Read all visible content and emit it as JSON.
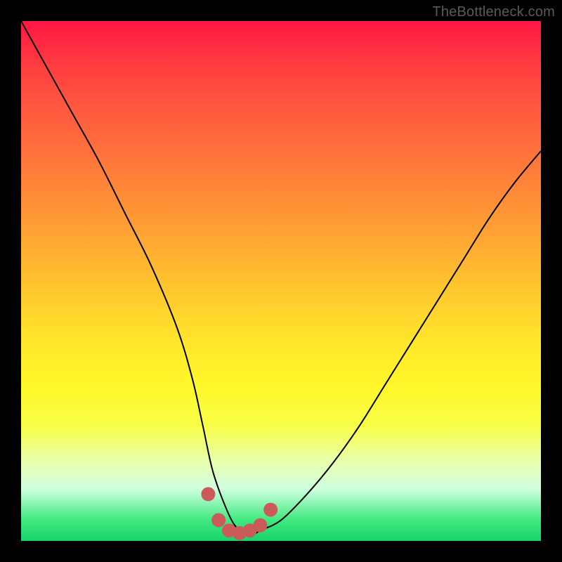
{
  "watermark": "TheBottleneck.com",
  "chart_data": {
    "type": "line",
    "title": "",
    "xlabel": "",
    "ylabel": "",
    "xlim": [
      0,
      100
    ],
    "ylim": [
      0,
      100
    ],
    "series": [
      {
        "name": "bottleneck-curve",
        "x": [
          0,
          5,
          10,
          15,
          20,
          25,
          30,
          33,
          35,
          37,
          40,
          42,
          44,
          46,
          50,
          55,
          60,
          65,
          70,
          75,
          80,
          85,
          90,
          95,
          100
        ],
        "y": [
          100,
          91,
          82,
          73,
          63,
          53,
          41,
          31,
          22,
          13,
          5,
          2,
          1,
          2,
          4,
          9,
          15,
          22,
          30,
          38,
          46,
          54,
          62,
          69,
          75
        ],
        "stroke": "#000000",
        "width": 2
      }
    ],
    "overlay": {
      "name": "trough-marker",
      "type": "scatter",
      "x": [
        36,
        38,
        40,
        42,
        44,
        46,
        48
      ],
      "y": [
        9,
        4,
        2,
        1.5,
        2,
        3,
        6
      ],
      "marker_color": "#cc5a5a",
      "marker_radius": 10
    },
    "background_gradient": {
      "stops": [
        {
          "pos": 0.0,
          "color": "#ff1744"
        },
        {
          "pos": 0.28,
          "color": "#ff7a3a"
        },
        {
          "pos": 0.52,
          "color": "#ffc82e"
        },
        {
          "pos": 0.78,
          "color": "#f8ff48"
        },
        {
          "pos": 0.96,
          "color": "#3fe97f"
        },
        {
          "pos": 1.0,
          "color": "#17d36a"
        }
      ]
    }
  }
}
